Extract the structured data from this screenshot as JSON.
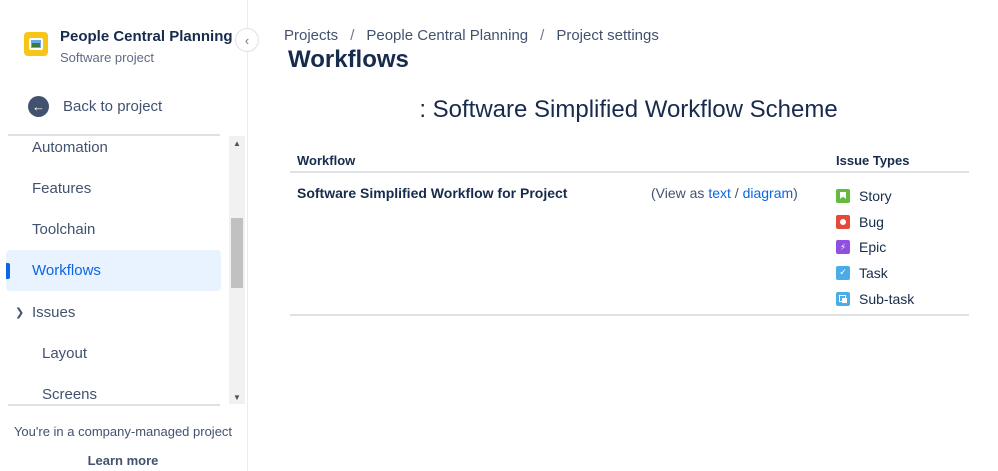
{
  "sidebar": {
    "project_name": "People Central Planning",
    "project_type": "Software project",
    "back_label": "Back to project",
    "collapse_glyph": "‹",
    "items": [
      {
        "label": "Automation"
      },
      {
        "label": "Features"
      },
      {
        "label": "Toolchain"
      },
      {
        "label": "Workflows",
        "active": true
      },
      {
        "label": "Issues",
        "expanded": true
      },
      {
        "label": "Layout"
      },
      {
        "label": "Screens"
      }
    ],
    "company_note": "You're in a company-managed project",
    "learn_more": "Learn more"
  },
  "breadcrumb": [
    "Projects",
    "People Central Planning",
    "Project settings"
  ],
  "page_title": "Workflows",
  "scheme_title": ": Software Simplified Workflow Scheme",
  "table": {
    "headers": {
      "workflow": "Workflow",
      "issue_types": "Issue Types"
    },
    "rows": [
      {
        "workflow": "Software Simplified Workflow for Project",
        "view_prefix": "(View as",
        "view_text": "text",
        "view_sep": "/",
        "view_diagram": "diagram",
        "view_suffix": ")",
        "issue_types": [
          {
            "name": "Story",
            "icon": "story-icon",
            "color": "#63ba3c"
          },
          {
            "name": "Bug",
            "icon": "bug-icon",
            "color": "#e5493a"
          },
          {
            "name": "Epic",
            "icon": "epic-icon",
            "color": "#904ee2"
          },
          {
            "name": "Task",
            "icon": "task-icon",
            "color": "#4bade8"
          },
          {
            "name": "Sub-task",
            "icon": "subtask-icon",
            "color": "#4bade8"
          }
        ]
      }
    ]
  },
  "colors": {
    "accent": "#0c66e4",
    "active_bg": "#e9f2ff",
    "text": "#172b4d",
    "muted": "#42526e"
  }
}
